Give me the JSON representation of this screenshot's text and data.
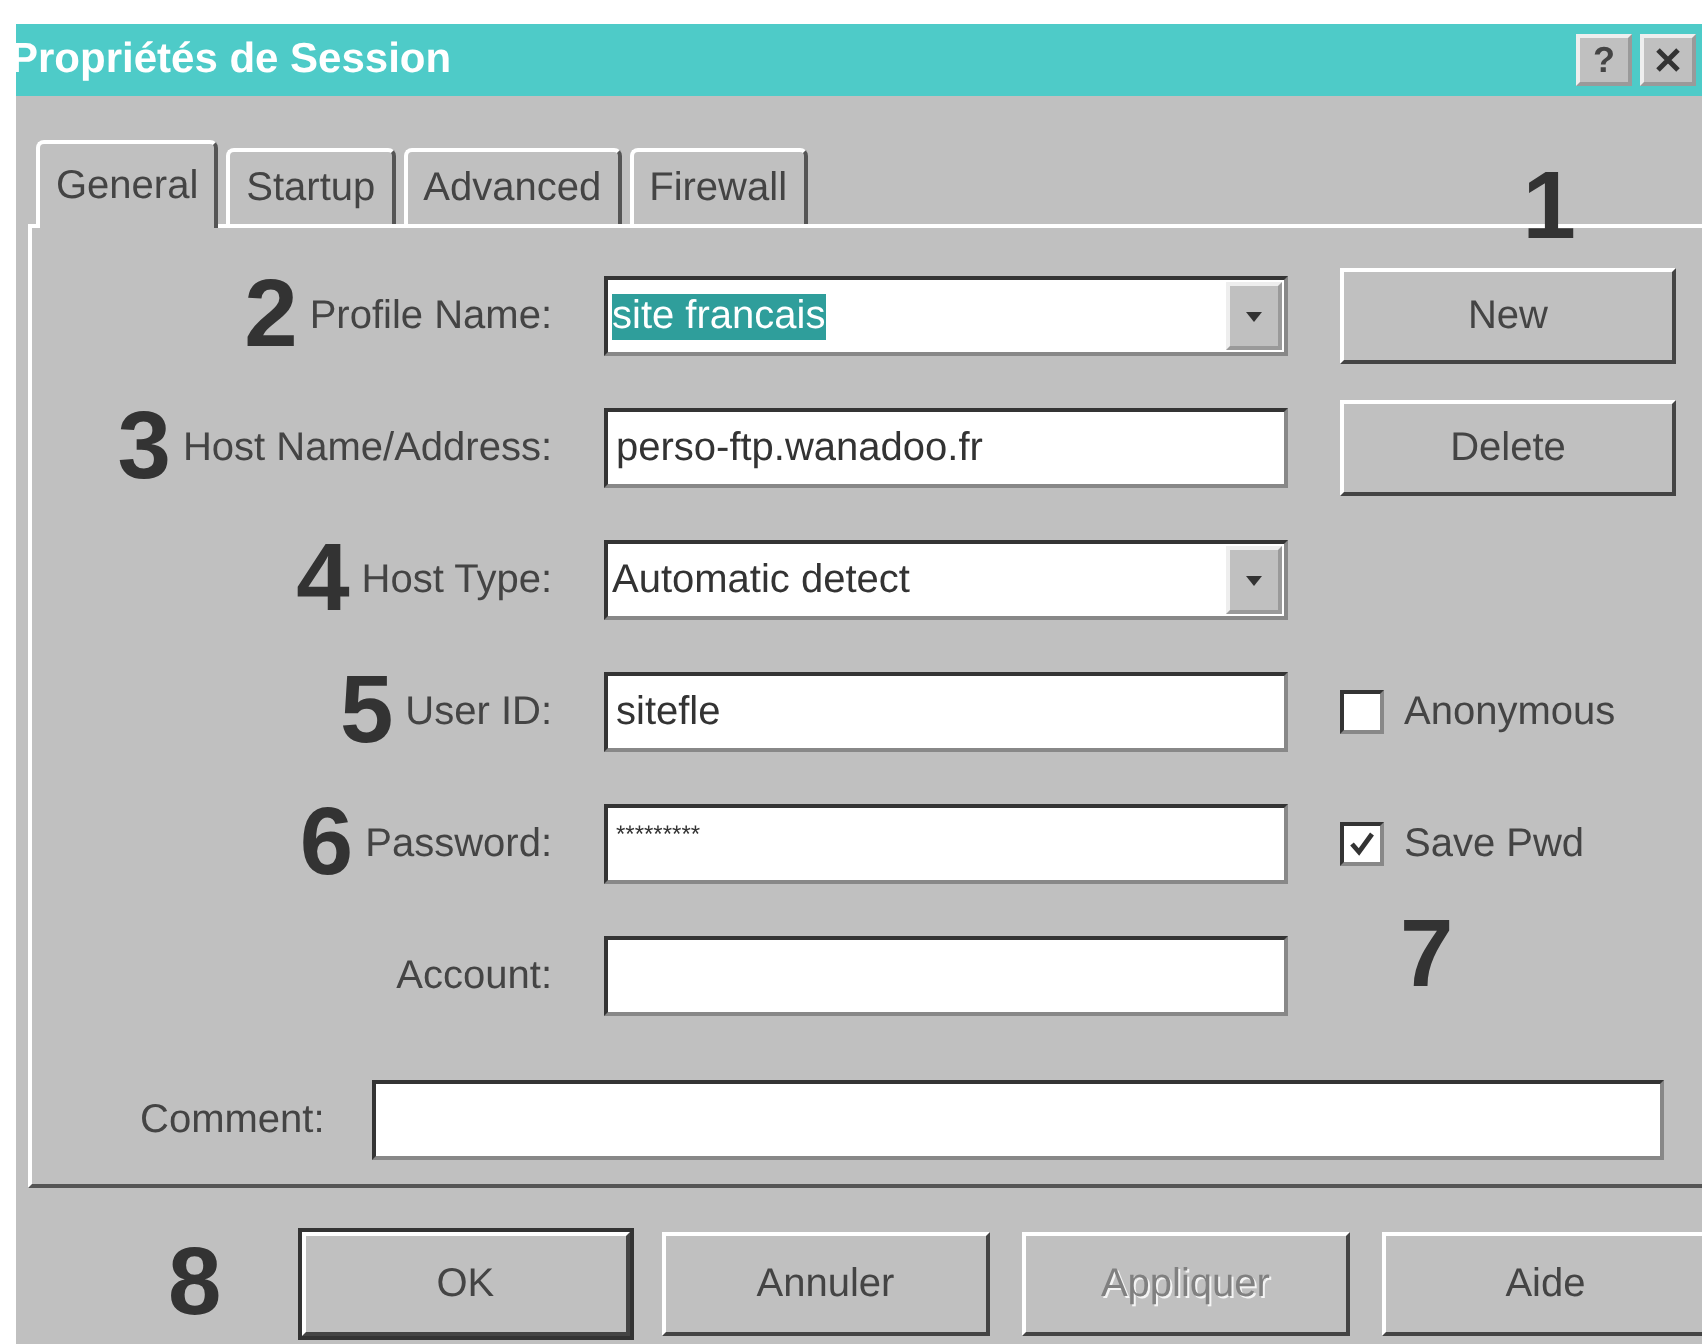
{
  "window": {
    "title": "Propriétés de Session",
    "help_button": "?"
  },
  "tabs": [
    {
      "label": "General",
      "selected": true
    },
    {
      "label": "Startup",
      "selected": false
    },
    {
      "label": "Advanced",
      "selected": false
    },
    {
      "label": "Firewall",
      "selected": false
    }
  ],
  "tab_marker": "1",
  "fields": [
    {
      "kind": "combo",
      "marker": "2",
      "label": "Profile Name:",
      "value": "site francais",
      "highlighted": true,
      "side": {
        "kind": "button",
        "label": "New"
      }
    },
    {
      "kind": "text",
      "marker": "3",
      "label": "Host Name/Address:",
      "value": "perso-ftp.wanadoo.fr",
      "side": {
        "kind": "button",
        "label": "Delete"
      }
    },
    {
      "kind": "combo",
      "marker": "4",
      "label": "Host Type:",
      "value": "Automatic detect",
      "highlighted": false
    },
    {
      "kind": "text",
      "marker": "5",
      "label": "User ID:",
      "value": "sitefle",
      "side": {
        "kind": "checkbox",
        "label": "Anonymous",
        "checked": false
      }
    },
    {
      "kind": "password",
      "marker": "6",
      "label": "Password:",
      "value": "*********",
      "side": {
        "kind": "checkbox",
        "label": "Save Pwd",
        "checked": true
      }
    },
    {
      "kind": "text",
      "label": "Account:",
      "side": {
        "kind": "marker",
        "text": "7"
      }
    }
  ],
  "comment": {
    "label": "Comment:"
  },
  "footer": {
    "marker": "8",
    "buttons": [
      {
        "label": "OK",
        "default": true,
        "disabled": false
      },
      {
        "label": "Annuler",
        "default": false,
        "disabled": false
      },
      {
        "label": "Appliquer",
        "default": false,
        "disabled": true
      },
      {
        "label": "Aide",
        "default": false,
        "disabled": false
      }
    ]
  }
}
